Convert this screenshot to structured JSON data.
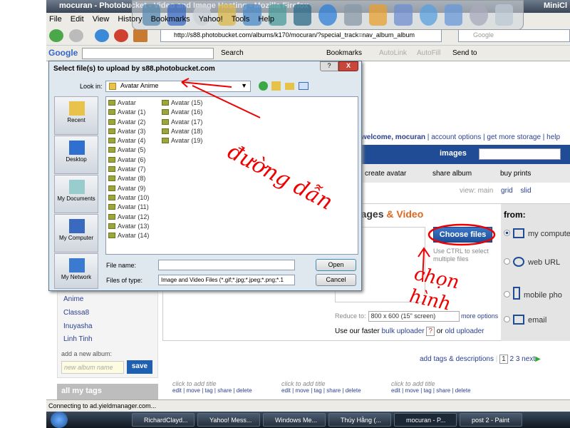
{
  "browser": {
    "title": "mocuran - Photobucket - Video and Image Hosting - Mozilla Firefox",
    "title_right": "MiniCl",
    "menu": [
      "File",
      "Edit",
      "View",
      "History",
      "Bookmarks",
      "Yahoo!",
      "Tools",
      "Help"
    ],
    "url": "http://s88.photobucket.com/albums/k170/mocuran/?special_track=nav_album_album",
    "search_placeholder": "Google",
    "google_toolbar": {
      "logo": "Google",
      "search": "Search",
      "bookmarks": "Bookmarks",
      "autolink": "AutoLink",
      "autofill": "AutoFill",
      "send_to": "Send to"
    },
    "status": "Connecting to ad.yieldmanager.com..."
  },
  "dialog": {
    "title": "Select file(s) to upload by s88.photobucket.com",
    "help": "?",
    "close": "X",
    "look_in_label": "Look in:",
    "look_in_value": "Avatar Anime",
    "places": [
      "Recent",
      "Desktop",
      "My Documents",
      "My Computer",
      "My Network"
    ],
    "files_col1": [
      "Avatar",
      "Avatar (1)",
      "Avatar (2)",
      "Avatar (3)",
      "Avatar (4)",
      "Avatar (5)",
      "Avatar (6)",
      "Avatar (7)",
      "Avatar (8)",
      "Avatar (9)",
      "Avatar (10)",
      "Avatar (11)",
      "Avatar (12)",
      "Avatar (13)",
      "Avatar (14)"
    ],
    "files_col2": [
      "Avatar (15)",
      "Avatar (16)",
      "Avatar (17)",
      "Avatar (18)",
      "Avatar (19)"
    ],
    "file_name_label": "File name:",
    "file_name_value": "",
    "file_type_label": "Files of type:",
    "file_type_value": "Image and Video Files (*.gif;*.jpg;*.jpeg;*.png;*.1",
    "open": "Open",
    "cancel": "Cancel"
  },
  "page": {
    "welcome": "welcome, mocuran",
    "account_options": "account options",
    "get_more_storage": "get more storage",
    "help": "help",
    "images_label": "images",
    "subnav": {
      "create_avatar": "create avatar",
      "share_album": "share album",
      "buy_prints": "buy prints"
    },
    "view": {
      "label": "view:",
      "main": "main",
      "grid": "grid",
      "slide": "slid"
    },
    "upload": {
      "title_a": "ad Images",
      "title_b": "& Video",
      "choose": "Choose files",
      "hint": "Use CTRL to select multiple files",
      "reduce_label": "Reduce to:",
      "reduce_value": "800 x 600 (15\" screen)",
      "more_options": "more options",
      "bulk_prefix": "Use our faster",
      "bulk": "bulk uploader",
      "q": "?",
      "or": "or",
      "old": "old uploader",
      "from": "from:",
      "sources": [
        "my compute",
        "web URL",
        "mobile pho",
        "email"
      ],
      "selected_source": "my compute"
    },
    "albums": [
      "Anime",
      "Classa8",
      "Inuyasha",
      "Linh Tinh"
    ],
    "add_album_label": "add a new album:",
    "add_album_placeholder": "new album name",
    "save": "save",
    "all_tags": "all my tags",
    "pager": {
      "add_tags": "add tags & descriptions",
      "pages": [
        "1",
        "2",
        "3"
      ],
      "current": "1",
      "next": "next"
    },
    "thumbs": [
      {
        "title": "click to add title"
      },
      {
        "title": "click to add title"
      },
      {
        "title": "click to add title"
      }
    ],
    "thumb_actions": [
      "edit",
      "move",
      "tag",
      "share",
      "delete"
    ]
  },
  "taskbar": {
    "tasks": [
      "RichardClayd...",
      "Yahoo! Mess...",
      "Windows Me...",
      "Thúy Hằng (...",
      "mocuran - P...",
      "post 2 - Paint"
    ]
  },
  "annotations": {
    "path": "đường dẫn",
    "choose": "chọn hình",
    "color": "#e00000"
  },
  "colors": {
    "accent": "#1f4c94",
    "link": "#2b3f8f",
    "orange": "#e0661f"
  }
}
